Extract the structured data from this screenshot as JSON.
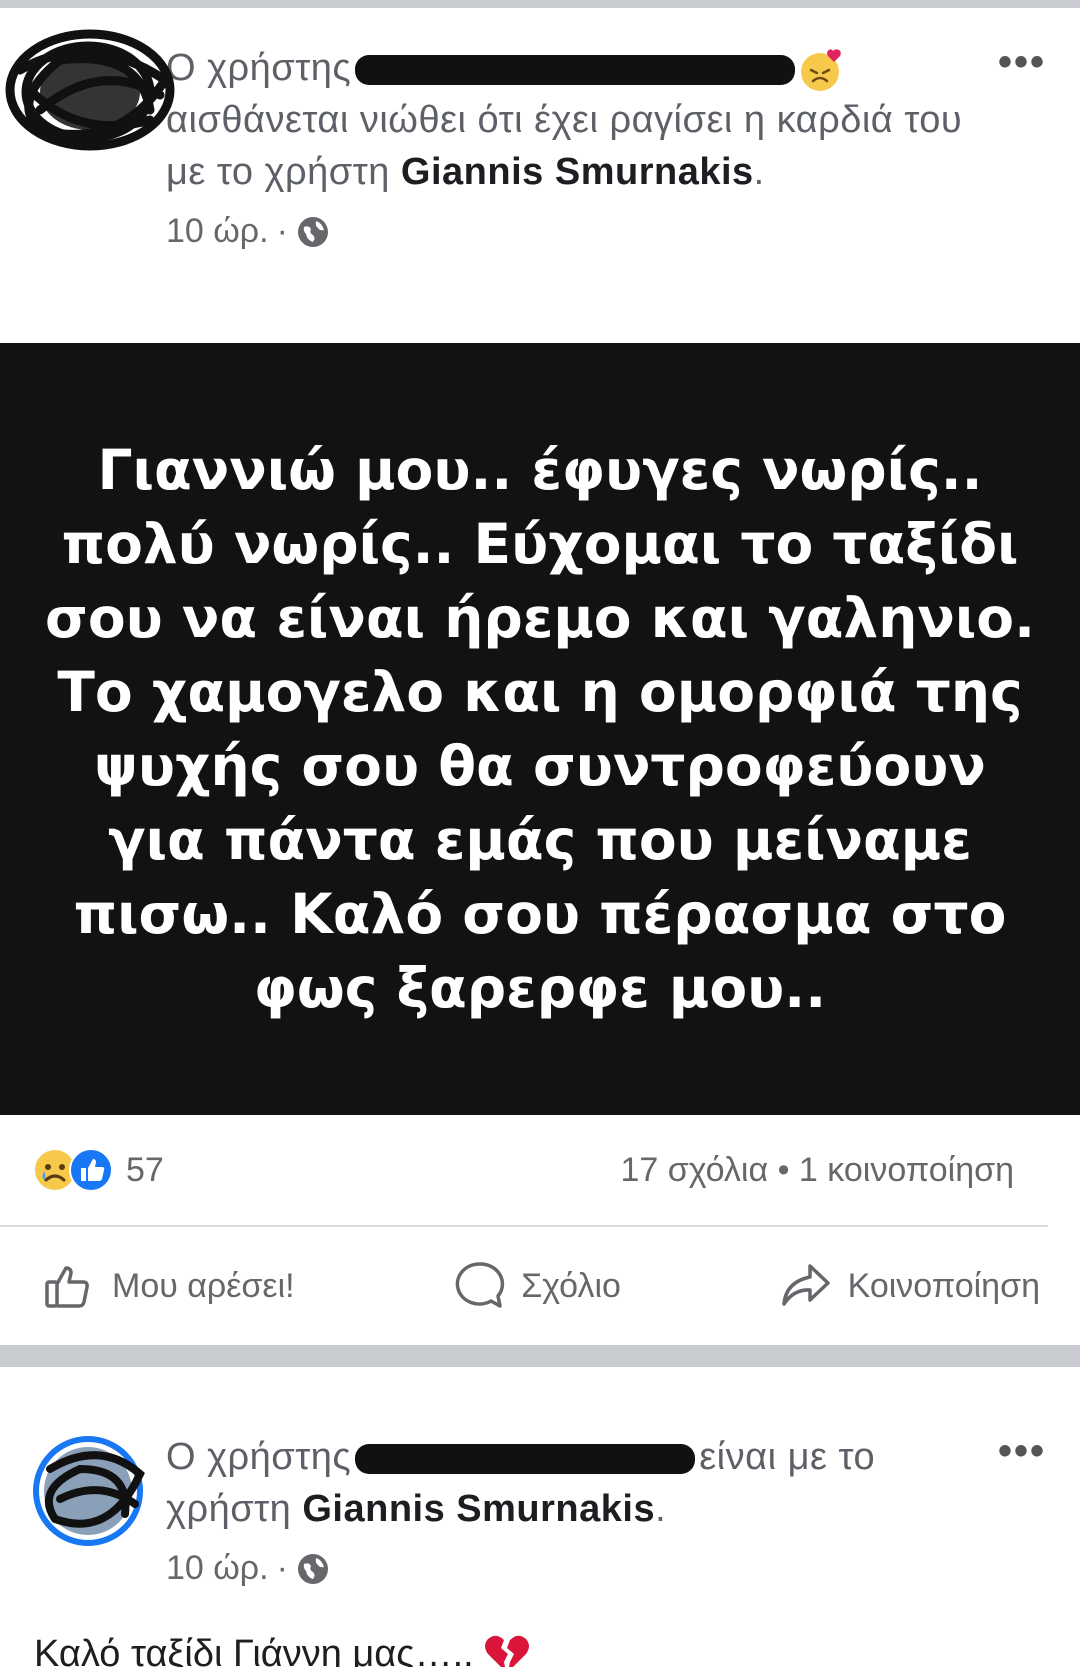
{
  "post1": {
    "prefix": "Ο χρήστης",
    "line1_rest": "αισθάνεται νιώθει ότι έχει ραγίσει η καρδιά του με το χρήστη",
    "tagged": "Giannis Smurnakis",
    "period": ".",
    "time": "10 ώρ.",
    "separator": "·",
    "more": "•••",
    "emoji": "heartbroken-face-icon",
    "image_text": "Γιαννιώ μου.. έφυγες νωρίς.. πολύ νωρίς.. Εύχομαι το ταξίδι σου να είναι ήρεμο και γαληνιο. Το χαμογελο και η ομορφιά της ψυχής σου θα συντροφεύουν για πάντα εμάς που μείναμε πισω.. Καλό σου πέρασμα στο φως ξαρερφε μου..",
    "reactions_count": "57",
    "comments": "17 σχόλια",
    "dot": "•",
    "shares": "1 κοινοποίηση",
    "like_label": "Μου αρέσει!",
    "comment_label": "Σχόλιο",
    "share_label": "Κοινοποίηση"
  },
  "post2": {
    "prefix": "Ο χρήστης",
    "rest": "είναι με το χρήστη",
    "tagged": "Giannis Smurnakis",
    "period": ".",
    "time": "10 ώρ.",
    "separator": "·",
    "more": "•••",
    "body": "Καλό ταξίδι Γιάννη μας….."
  },
  "colors": {
    "background": "#ffffff",
    "card": "#121212",
    "muted_text": "#65676b",
    "divider": "#c9ccd1",
    "like_blue": "#1877f2"
  }
}
